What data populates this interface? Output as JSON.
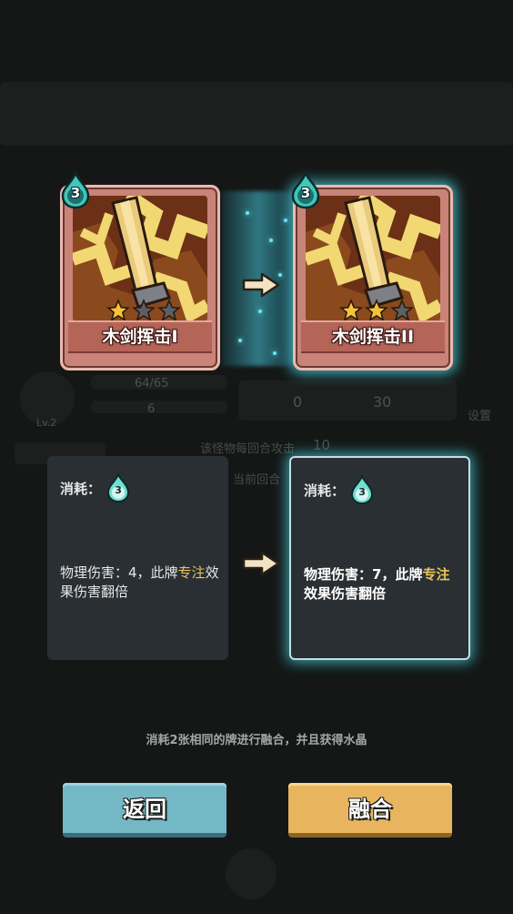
{
  "background": {
    "hp_text": "64/65",
    "shield_value": "6",
    "attack_value": "0",
    "coin_value": "30",
    "level": "Lv.2",
    "settings_label": "设置",
    "status_text_1": "该怪物每回合攻击",
    "status_value_1": "10",
    "status_text_2": "当前回合"
  },
  "cards": [
    {
      "name": "木剑挥击I",
      "cost": "3",
      "stars_filled": 1,
      "stars_total": 3
    },
    {
      "name": "木剑挥击II",
      "cost": "3",
      "stars_filled": 2,
      "stars_total": 3
    }
  ],
  "panels": [
    {
      "cost_label": "消耗：",
      "cost": "3",
      "desc_prefix": "物理伤害：4，此牌",
      "desc_keyword": "专注",
      "desc_suffix": "效果伤害翻倍"
    },
    {
      "cost_label": "消耗：",
      "cost": "3",
      "desc_prefix": "物理伤害：7，此牌",
      "desc_keyword": "专注",
      "desc_suffix": "效果伤害翻倍"
    }
  ],
  "hint": "消耗2张相同的牌进行融合，并且获得水晶",
  "buttons": {
    "back": "返回",
    "fuse": "融合"
  },
  "colors": {
    "glow": "#4ad6e6",
    "keyword": "#e9c45a",
    "back_button": "#74b7c5",
    "fuse_button": "#e8b55e"
  },
  "icons": [
    "water-drop-icon",
    "star-icon",
    "arrow-right-icon",
    "sword-art"
  ]
}
